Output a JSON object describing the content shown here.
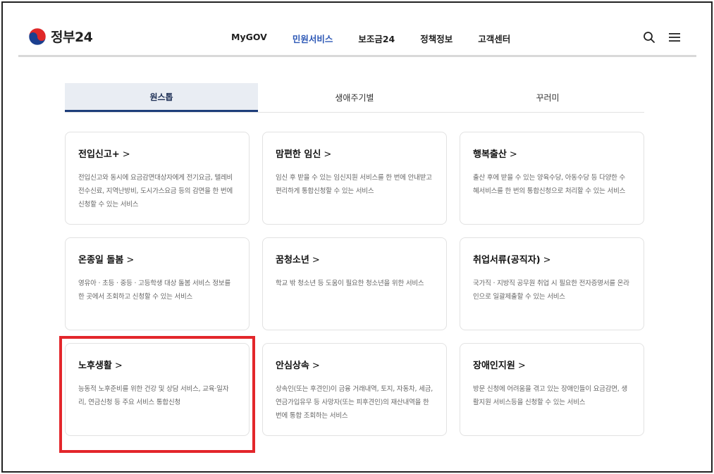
{
  "header": {
    "logo_text": "정부24",
    "nav": [
      "MyGOV",
      "민원서비스",
      "보조금24",
      "정책정보",
      "고객센터"
    ],
    "active_nav": "민원서비스",
    "icons": [
      "search-icon",
      "menu-icon"
    ]
  },
  "tabs": [
    {
      "label": "원스톱",
      "active": true
    },
    {
      "label": "생애주기별",
      "active": false
    },
    {
      "label": "꾸러미",
      "active": false
    }
  ],
  "cards": [
    {
      "title": "전입신고+",
      "arrow": ">",
      "desc": "전입신고와 동시에 요금감면대상자에게 전기요금, 텔레비전수신료, 지역난방비, 도시가스요금 등의 감면을 한 번에 신청할 수 있는 서비스"
    },
    {
      "title": "맘편한 임신",
      "arrow": ">",
      "desc": "임신 후 받을 수 있는 임신지원 서비스를 한 번에 안내받고 편리하게 통합신청할 수 있는 서비스"
    },
    {
      "title": "행복출산",
      "arrow": ">",
      "desc": "출산 후에 받을 수 있는 양육수당, 아동수당 등 다양한 수혜서비스를 한 번의 통합신청으로 처리할 수 있는 서비스"
    },
    {
      "title": "온종일 돌봄",
      "arrow": ">",
      "desc": "영유아 · 초등 · 중등 · 고등학생 대상 돌봄 서비스 정보를 한 곳에서 조회하고 신청할 수 있는 서비스"
    },
    {
      "title": "꿈청소년",
      "arrow": ">",
      "desc": "학교 밖 청소년 등 도움이 필요한 청소년을 위한 서비스"
    },
    {
      "title": "취업서류(공직자)",
      "arrow": ">",
      "desc": "국가직 · 지방직 공무원 취업 시 필요한 전자증명서를 온라인으로 일괄제출할 수 있는 서비스"
    },
    {
      "title": "노후생활",
      "arrow": ">",
      "desc": "능동적 노후준비를 위한 건강 및 상담 서비스, 교육·일자리, 연금신청 등 주요 서비스 통합신청"
    },
    {
      "title": "안심상속",
      "arrow": ">",
      "desc": "상속인(또는 후견인)이 금융 거래내역, 토지, 자동차, 세금, 연금가입유무 등 사망자(또는 피후견인)의 재산내역을 한 번에 통합 조회하는 서비스"
    },
    {
      "title": "장애인지원",
      "arrow": ">",
      "desc": "방문 신청에 어려움을 겪고 있는 장애인들이 요금감면, 생활지원 서비스등을 신청할 수 있는 서비스"
    }
  ],
  "highlight": {
    "target": "노후생활",
    "color": "#e3262b"
  },
  "colors": {
    "accent": "#2d58b6",
    "tab_active_bg": "#e9edf3",
    "tab_active_border": "#1d3d7a"
  }
}
